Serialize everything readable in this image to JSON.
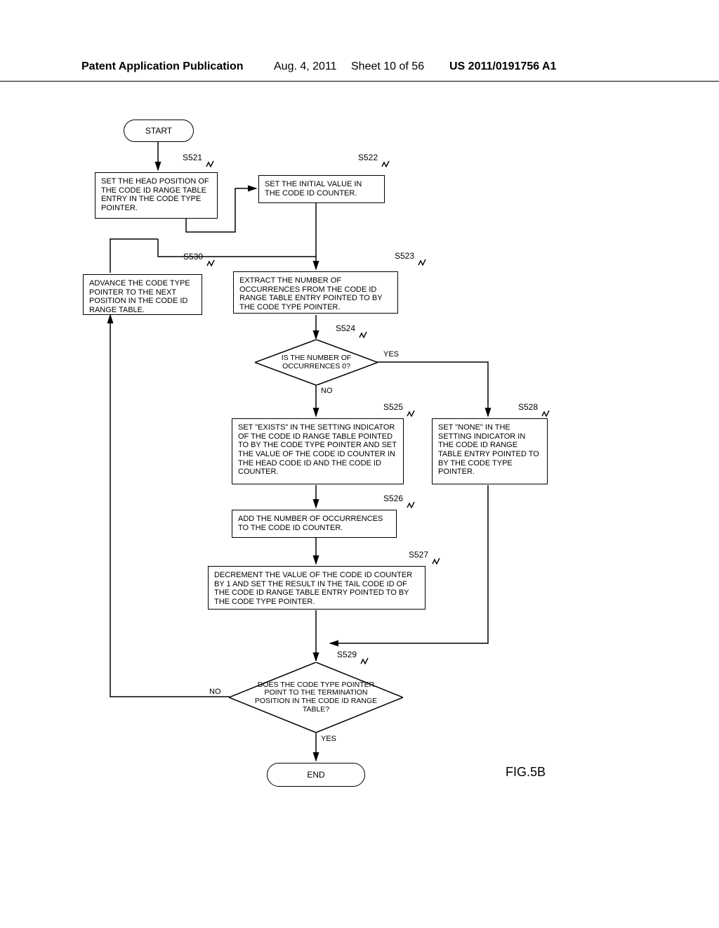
{
  "header": {
    "publication": "Patent Application Publication",
    "date": "Aug. 4, 2011",
    "sheet": "Sheet 10 of 56",
    "pub_number": "US 2011/0191756 A1"
  },
  "figure_label": "FIG.5B",
  "terminators": {
    "start": "START",
    "end": "END"
  },
  "steps": {
    "s521": {
      "id": "S521",
      "text": "SET THE HEAD POSITION OF THE CODE ID RANGE TABLE ENTRY IN THE CODE TYPE POINTER."
    },
    "s522": {
      "id": "S522",
      "text": "SET THE INITIAL VALUE IN THE CODE ID COUNTER."
    },
    "s523": {
      "id": "S523",
      "text": "EXTRACT THE NUMBER OF OCCURRENCES FROM THE CODE ID RANGE TABLE ENTRY POINTED TO BY THE CODE TYPE POINTER."
    },
    "s525": {
      "id": "S525",
      "text": "SET \"EXISTS\" IN THE SETTING INDICATOR OF THE CODE ID RANGE TABLE POINTED TO BY THE CODE TYPE POINTER AND SET THE VALUE OF THE CODE ID COUNTER IN THE HEAD CODE ID AND THE CODE ID COUNTER."
    },
    "s526": {
      "id": "S526",
      "text": "ADD THE NUMBER OF OCCURRENCES TO THE CODE ID COUNTER."
    },
    "s527": {
      "id": "S527",
      "text": "DECREMENT THE VALUE OF THE CODE ID COUNTER BY 1 AND SET THE RESULT IN THE TAIL CODE ID OF THE CODE ID RANGE TABLE ENTRY POINTED TO BY THE CODE TYPE POINTER."
    },
    "s528": {
      "id": "S528",
      "text": "SET \"NONE\" IN THE SETTING INDICATOR IN THE CODE ID RANGE TABLE ENTRY POINTED TO BY THE CODE TYPE POINTER."
    },
    "s530": {
      "id": "S530",
      "text": "ADVANCE THE CODE TYPE POINTER TO THE NEXT POSITION IN THE CODE ID RANGE TABLE."
    }
  },
  "decisions": {
    "s524": {
      "id": "S524",
      "text": "IS THE NUMBER OF OCCURRENCES 0?"
    },
    "s529": {
      "id": "S529",
      "text": "DOES THE CODE TYPE POINTER POINT TO THE TERMINATION POSITION IN THE CODE ID RANGE TABLE?"
    }
  },
  "paths": {
    "yes": "YES",
    "no": "NO"
  }
}
